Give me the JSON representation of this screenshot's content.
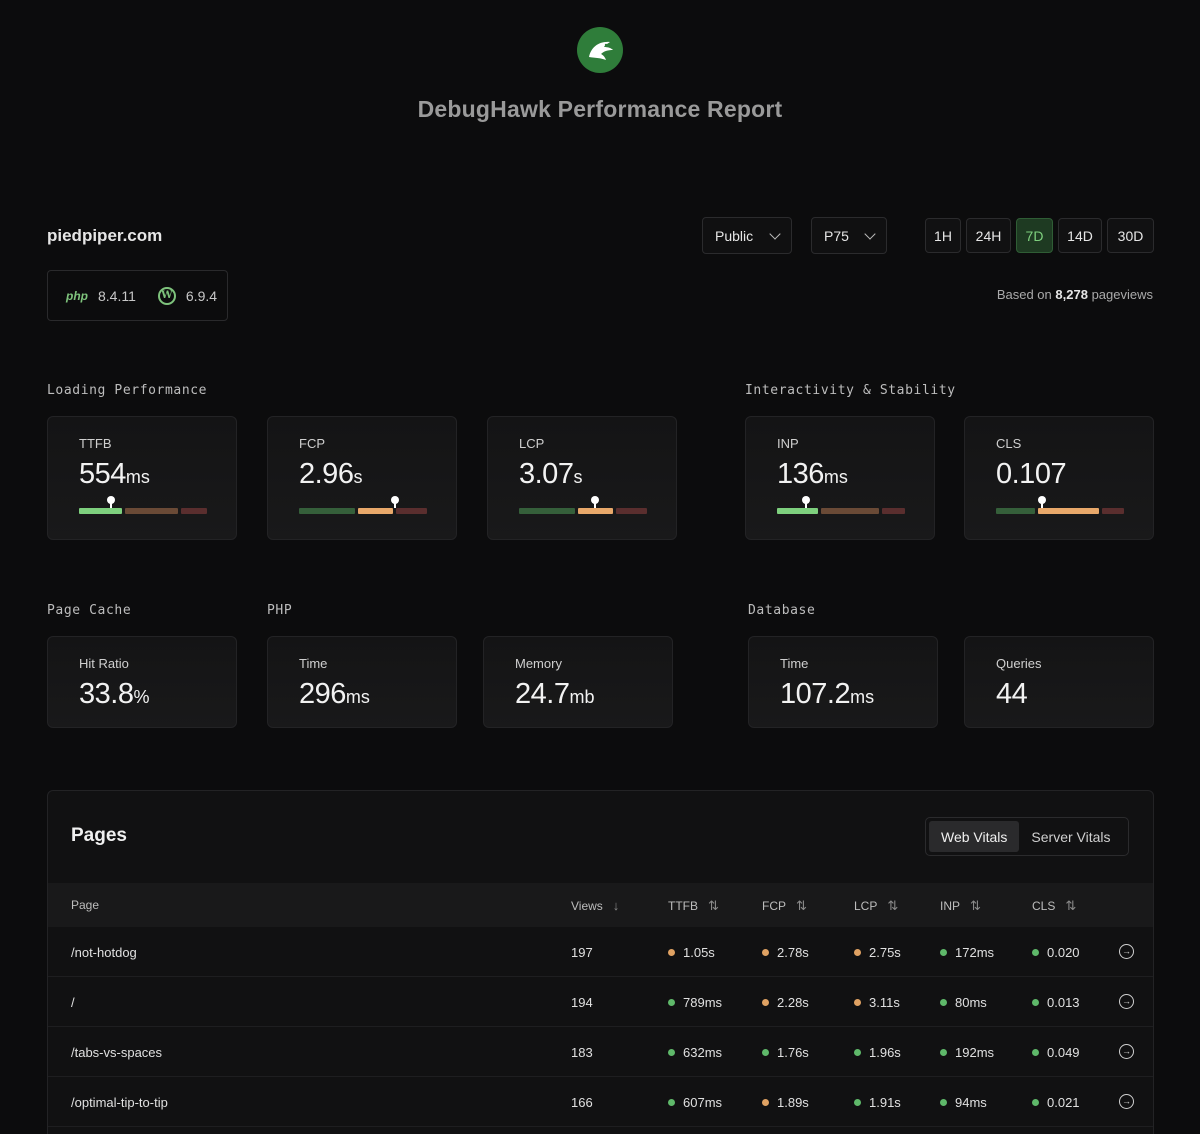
{
  "header": {
    "title": "DebugHawk Performance Report"
  },
  "site": {
    "name": "piedpiper.com",
    "php_version": "8.4.11",
    "php_label": "php",
    "wp_version": "6.9.4"
  },
  "filters": {
    "visibility": "Public",
    "percentile": "P75",
    "ranges": [
      "1H",
      "24H",
      "7D",
      "14D",
      "30D"
    ],
    "active_range": "7D"
  },
  "pageviews": {
    "prefix": "Based on",
    "count": "8,278",
    "suffix": "pageviews"
  },
  "sections": {
    "loading": "Loading Performance",
    "interactivity": "Interactivity & Stability",
    "cache": "Page Cache",
    "php": "PHP",
    "database": "Database"
  },
  "vitals": [
    {
      "label": "TTFB",
      "value": "554",
      "unit": "ms",
      "position": 0.25,
      "good_frac": 0.36,
      "mid_frac": 0.44
    },
    {
      "label": "FCP",
      "value": "2.96",
      "unit": "s",
      "position": 0.75,
      "good_frac": 0.46,
      "mid_frac": 0.3
    },
    {
      "label": "LCP",
      "value": "3.07",
      "unit": "s",
      "position": 0.59,
      "good_frac": 0.46,
      "mid_frac": 0.3
    },
    {
      "label": "INP",
      "value": "136",
      "unit": "ms",
      "position": 0.23,
      "good_frac": 0.34,
      "mid_frac": 0.48
    },
    {
      "label": "CLS",
      "value": "0.107",
      "unit": "",
      "position": 0.36,
      "good_frac": 0.33,
      "mid_frac": 0.5
    }
  ],
  "server": [
    {
      "label": "Hit Ratio",
      "value": "33.8",
      "unit": "%"
    },
    {
      "label": "Time",
      "value": "296",
      "unit": "ms"
    },
    {
      "label": "Memory",
      "value": "24.7",
      "unit": "mb"
    },
    {
      "label": "Time",
      "value": "107.2",
      "unit": "ms"
    },
    {
      "label": "Queries",
      "value": "44",
      "unit": ""
    }
  ],
  "pages": {
    "title": "Pages",
    "tabs": [
      "Web Vitals",
      "Server Vitals"
    ],
    "active_tab": "Web Vitals",
    "columns": [
      "Page",
      "Views",
      "TTFB",
      "FCP",
      "LCP",
      "INP",
      "CLS"
    ],
    "rows": [
      {
        "page": "/not-hotdog",
        "views": "197",
        "ttfb": [
          "1.05s",
          "orange"
        ],
        "fcp": [
          "2.78s",
          "orange"
        ],
        "lcp": [
          "2.75s",
          "orange"
        ],
        "inp": [
          "172ms",
          "green"
        ],
        "cls": [
          "0.020",
          "green"
        ]
      },
      {
        "page": "/",
        "views": "194",
        "ttfb": [
          "789ms",
          "green"
        ],
        "fcp": [
          "2.28s",
          "orange"
        ],
        "lcp": [
          "3.11s",
          "orange"
        ],
        "inp": [
          "80ms",
          "green"
        ],
        "cls": [
          "0.013",
          "green"
        ]
      },
      {
        "page": "/tabs-vs-spaces",
        "views": "183",
        "ttfb": [
          "632ms",
          "green"
        ],
        "fcp": [
          "1.76s",
          "green"
        ],
        "lcp": [
          "1.96s",
          "green"
        ],
        "inp": [
          "192ms",
          "green"
        ],
        "cls": [
          "0.049",
          "green"
        ]
      },
      {
        "page": "/optimal-tip-to-tip",
        "views": "166",
        "ttfb": [
          "607ms",
          "green"
        ],
        "fcp": [
          "1.89s",
          "orange"
        ],
        "lcp": [
          "1.91s",
          "green"
        ],
        "inp": [
          "94ms",
          "green"
        ],
        "cls": [
          "0.021",
          "green"
        ]
      }
    ]
  },
  "colors": {
    "green": "#5fb96a",
    "orange": "#e0a263",
    "good_bar": "#355f3a",
    "mid_bar": "#6a4a36",
    "bad_bar": "#5a2e2e",
    "good_active": "#7ed07e",
    "mid_active": "#e8a86a",
    "bad_active": "#c05656"
  }
}
